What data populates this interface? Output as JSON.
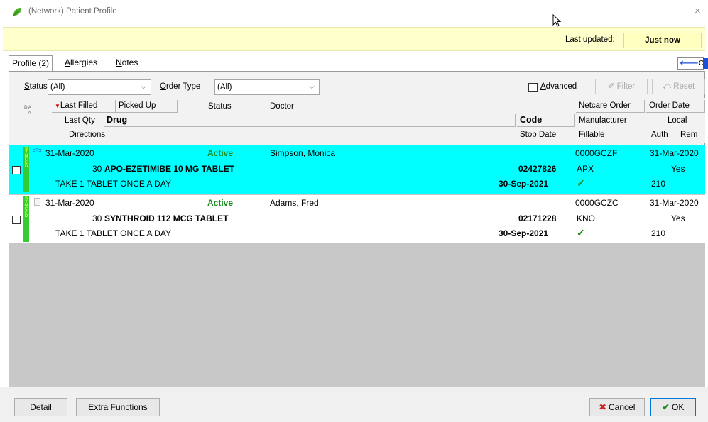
{
  "window": {
    "title": "(Network) Patient Profile",
    "close_glyph": "×"
  },
  "notice": {
    "last_updated_label": "Last updated:",
    "last_updated_value": "Just now"
  },
  "tabs": [
    {
      "label": "Profile (2)",
      "underline": "P",
      "rest": "rofile (2)"
    },
    {
      "label": "Allergies",
      "underline": "A",
      "rest": "llergies"
    },
    {
      "label": "Notes",
      "underline": "N",
      "rest": "otes"
    }
  ],
  "ctrl_label": "Ctrl",
  "filters": {
    "status_label_u": "S",
    "status_label_rest": "tatus",
    "status_value": "(All)",
    "order_type_label_u": "O",
    "order_type_label_rest": "rder Type",
    "order_type_value": "(All)",
    "advanced_u": "A",
    "advanced_rest": "dvanced",
    "filter_button": "Filter",
    "reset_button": "Reset"
  },
  "headers": {
    "data_vert": "D A T A",
    "last_filled": "Last Filled",
    "picked_up": "Picked Up",
    "status": "Status",
    "doctor": "Doctor",
    "netcare_order": "Netcare Order",
    "order_date": "Order Date",
    "last_qty": "Last Qty",
    "drug": "Drug",
    "code": "Code",
    "manufacturer": "Manufacturer",
    "local": "Local",
    "directions": "Directions",
    "stop_date": "Stop Date",
    "fillable": "Fillable",
    "auth": "Auth",
    "rem": "Rem"
  },
  "rows": [
    {
      "sync": "SYNCED",
      "erx": "eRx",
      "last_filled": "31-Mar-2020",
      "status": "Active",
      "doctor": "Simpson, Monica",
      "netcare_order": "0000GCZF",
      "order_date": "31-Mar-2020",
      "qty": "30",
      "drug": "APO-EZETIMIBE 10 MG TABLET",
      "code": "02427826",
      "manufacturer": "APX",
      "local": "Yes",
      "directions": "TAKE 1 TABLET ONCE A DAY",
      "stop_date": "30-Sep-2021",
      "fillable": "✓",
      "auth": "210",
      "row_color": "#00ffff"
    },
    {
      "sync": "SYNCED",
      "erx": "",
      "last_filled": "31-Mar-2020",
      "status": "Active",
      "doctor": "Adams, Fred",
      "netcare_order": "0000GCZC",
      "order_date": "31-Mar-2020",
      "qty": "30",
      "drug": "SYNTHROID 112 MCG TABLET",
      "code": "02171228",
      "manufacturer": "KNO",
      "local": "Yes",
      "directions": "TAKE 1 TABLET ONCE A DAY",
      "stop_date": "30-Sep-2021",
      "fillable": "✓",
      "auth": "210",
      "row_color": "#ffffff"
    }
  ],
  "footer": {
    "detail_u": "D",
    "detail_rest": "etail",
    "extra_u": "x",
    "extra_pre": "E",
    "extra_rest": "tra Functions",
    "cancel": "Cancel",
    "ok": "OK"
  },
  "colors": {
    "selected_row": "#00ffff",
    "notice_bg": "#ffffcc",
    "active_text": "#1a8a1a",
    "sync_strip": "#33cc33"
  }
}
